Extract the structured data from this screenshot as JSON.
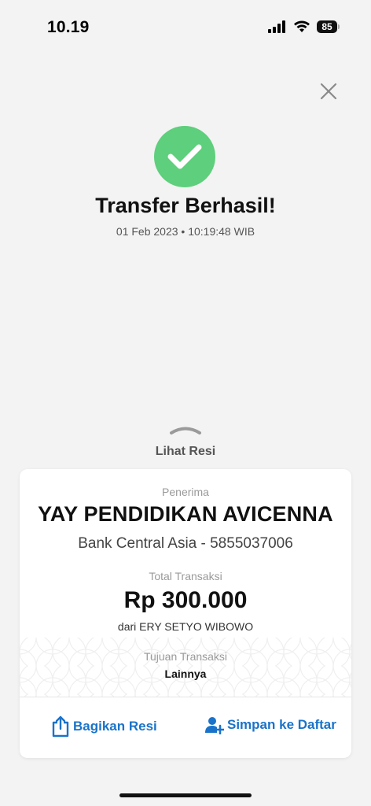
{
  "status_bar": {
    "time": "10.19",
    "battery": "85"
  },
  "result": {
    "title": "Transfer Berhasil!",
    "datetime": "01 Feb 2023 • 10:19:48 WIB"
  },
  "receipt_toggle": {
    "label": "Lihat Resi"
  },
  "receipt": {
    "recipient_label": "Penerima",
    "recipient_name": "YAY PENDIDIKAN AVICENNA",
    "bank_line": "Bank Central Asia - 5855037006",
    "total_label": "Total Transaksi",
    "amount": "Rp 300.000",
    "sender": "dari ERY SETYO WIBOWO",
    "purpose_label": "Tujuan Transaksi",
    "purpose": "Lainnya"
  },
  "actions": {
    "share_label": "Bagikan Resi",
    "save_label": "Simpan ke Daftar"
  },
  "colors": {
    "success": "#5ecf7c",
    "accent": "#1a73c9",
    "background": "#f3f3f3"
  },
  "icons": [
    "signal-icon",
    "wifi-icon",
    "battery-icon",
    "close-icon",
    "checkmark-icon",
    "chevron-up-icon",
    "share-icon",
    "add-contact-icon"
  ]
}
